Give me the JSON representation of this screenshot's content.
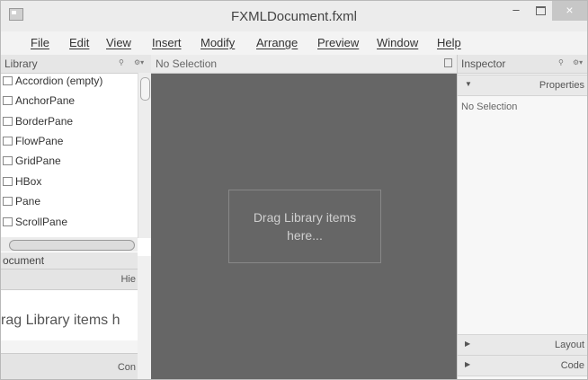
{
  "window": {
    "title": "FXMLDocument.fxml",
    "controls": {
      "minimize": "–",
      "close": "×"
    }
  },
  "menu": [
    "File",
    "Edit",
    "View",
    "Insert",
    "Modify",
    "Arrange",
    "Preview",
    "Window",
    "Help"
  ],
  "library": {
    "title": "Library",
    "items": [
      "Accordion (empty)",
      "AnchorPane",
      "BorderPane",
      "FlowPane",
      "GridPane",
      "HBox",
      "Pane",
      "ScrollPane"
    ]
  },
  "document": {
    "title": "ocument",
    "tab_hierarchy": "Hie",
    "placeholder": "rag Library items h",
    "tab_controller": "Con"
  },
  "stage": {
    "selection_label": "No Selection",
    "drop_hint_line1": "Drag Library items",
    "drop_hint_line2": "here..."
  },
  "inspector": {
    "title": "Inspector",
    "sections": {
      "properties": "Properties",
      "layout": "Layout",
      "code": "Code"
    },
    "no_selection": "No Selection"
  },
  "icons": {
    "menu_small": "⚙▾",
    "search_small": "🔍"
  }
}
